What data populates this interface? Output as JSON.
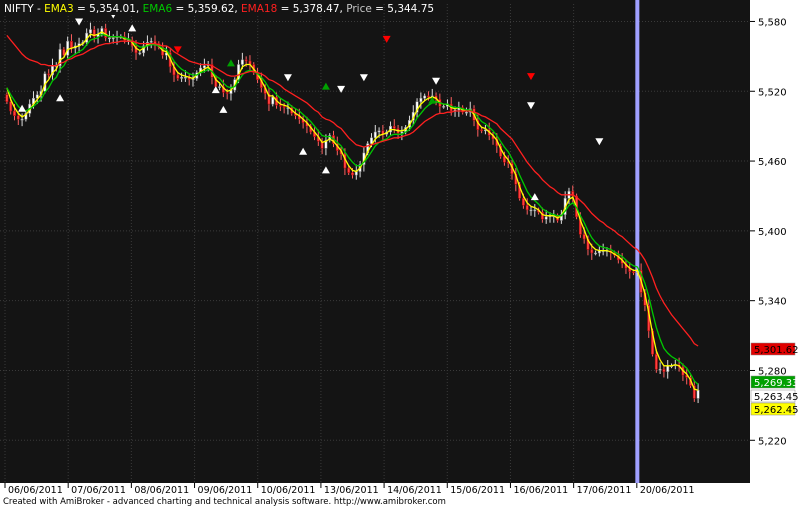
{
  "header": {
    "symbol": "NIFTY",
    "sep": " - ",
    "items": [
      {
        "label": "EMA3",
        "value": " = 5,354.01, ",
        "color": "#ffff00"
      },
      {
        "label": "EMA6",
        "value": " = 5,359.62, ",
        "color": "#00c800"
      },
      {
        "label": "EMA18",
        "value": " = 5,378.47, ",
        "color": "#ff2020"
      },
      {
        "label": "Price",
        "value": " = 5,344.75",
        "color": "#c8c8c8"
      }
    ]
  },
  "footer": {
    "credit": "Created with AmiBroker - advanced charting and technical analysis software. http://www.amibroker.com"
  },
  "chart_data": {
    "type": "candlestick",
    "symbol": "NIFTY",
    "x": [
      "06/06/2011",
      "07/06/2011",
      "08/06/2011",
      "09/06/2011",
      "10/06/2011",
      "13/06/2011",
      "14/06/2011",
      "15/06/2011",
      "16/06/2011",
      "17/06/2011",
      "20/06/2011"
    ],
    "ylim": [
      5185,
      5595
    ],
    "yticks": [
      5220,
      5280,
      5340,
      5400,
      5460,
      5520,
      5580
    ],
    "ytick_labels": [
      "5,220",
      "5,280",
      "5,340",
      "5,400",
      "5,460",
      "5,520",
      "5,580"
    ],
    "series": [
      {
        "name": "Price",
        "style": "candlestick",
        "up_color": "#ffffff",
        "down_color": "#ff4040",
        "close": [
          5511,
          5503,
          5499,
          5496,
          5496,
          5501,
          5509,
          5514,
          5517,
          5520,
          5535,
          5534,
          5542,
          5542,
          5556,
          5551,
          5563,
          5557,
          5559,
          5561,
          5562,
          5570,
          5573,
          5567,
          5569,
          5574,
          5566,
          5566,
          5566,
          5567,
          5567,
          5564,
          5564,
          5559,
          5553,
          5553,
          5559,
          5562,
          5563,
          5561,
          5558,
          5551,
          5553,
          5541,
          5534,
          5531,
          5532,
          5532,
          5530,
          5531,
          5536,
          5540,
          5542,
          5543,
          5532,
          5524,
          5524,
          5519,
          5518,
          5521,
          5530,
          5543,
          5547,
          5546,
          5543,
          5536,
          5530,
          5523,
          5518,
          5509,
          5515,
          5508,
          5507,
          5506,
          5506,
          5501,
          5499,
          5496,
          5493,
          5490,
          5485,
          5481,
          5477,
          5471,
          5478,
          5482,
          5475,
          5469,
          5466,
          5454,
          5450,
          5448,
          5451,
          5457,
          5467,
          5475,
          5480,
          5485,
          5486,
          5483,
          5485,
          5490,
          5488,
          5484,
          5485,
          5489,
          5495,
          5502,
          5511,
          5514,
          5516,
          5515,
          5516,
          5513,
          5507,
          5507,
          5509,
          5503,
          5504,
          5506,
          5502,
          5502,
          5505,
          5495,
          5487,
          5486,
          5487,
          5482,
          5479,
          5473,
          5464,
          5459,
          5458,
          5449,
          5440,
          5428,
          5422,
          5418,
          5418,
          5418,
          5416,
          5410,
          5412,
          5413,
          5413,
          5409,
          5414,
          5428,
          5434,
          5430,
          5412,
          5397,
          5393,
          5384,
          5381,
          5381,
          5383,
          5383,
          5383,
          5381,
          5379,
          5375,
          5372,
          5368,
          5365,
          5364,
          5366,
          5347,
          5336,
          5314,
          5294,
          5281,
          5281,
          5279,
          5284,
          5284,
          5285,
          5283,
          5276,
          5274,
          5267,
          5256,
          5263
        ]
      },
      {
        "name": "EMA3",
        "color": "#ffff00",
        "values": [
          5523,
          5513,
          5506,
          5501,
          5498,
          5500,
          5504,
          5509,
          5513,
          5517,
          5526,
          5530,
          5536,
          5539,
          5547,
          5549,
          5556,
          5557,
          5558,
          5559,
          5561,
          5565,
          5569,
          5568,
          5569,
          5571,
          5569,
          5567,
          5567,
          5567,
          5567,
          5565,
          5565,
          5562,
          5557,
          5555,
          5557,
          5560,
          5561,
          5561,
          5559,
          5555,
          5554,
          5548,
          5541,
          5536,
          5534,
          5533,
          5532,
          5531,
          5534,
          5537,
          5539,
          5541,
          5537,
          5530,
          5527,
          5523,
          5520,
          5521,
          5525,
          5534,
          5541,
          5543,
          5543,
          5539,
          5535,
          5529,
          5523,
          5516,
          5516,
          5512,
          5509,
          5508,
          5507,
          5504,
          5501,
          5499,
          5496,
          5493,
          5489,
          5485,
          5481,
          5476,
          5477,
          5479,
          5477,
          5473,
          5469,
          5462,
          5456,
          5452,
          5451,
          5454,
          5460,
          5468,
          5474,
          5479,
          5482,
          5483,
          5484,
          5487,
          5487,
          5486,
          5486,
          5487,
          5491,
          5497,
          5504,
          5509,
          5512,
          5514,
          5515,
          5514,
          5510,
          5509,
          5509,
          5506,
          5505,
          5506,
          5504,
          5503,
          5504,
          5500,
          5493,
          5489,
          5488,
          5485,
          5482,
          5478,
          5471,
          5465,
          5461,
          5455,
          5448,
          5438,
          5430,
          5424,
          5421,
          5420,
          5418,
          5414,
          5413,
          5413,
          5413,
          5411,
          5413,
          5420,
          5427,
          5429,
          5420,
          5409,
          5401,
          5392,
          5387,
          5384,
          5383,
          5383,
          5383,
          5382,
          5380,
          5378,
          5375,
          5371,
          5368,
          5366,
          5366,
          5357,
          5346,
          5330,
          5312,
          5297,
          5289,
          5284,
          5284,
          5284,
          5285,
          5284,
          5280,
          5277,
          5272,
          5264,
          5263
        ]
      },
      {
        "name": "EMA6",
        "color": "#00c800",
        "values": [
          5523,
          5517,
          5512,
          5507,
          5504,
          5503,
          5505,
          5507,
          5510,
          5513,
          5519,
          5523,
          5529,
          5532,
          5539,
          5542,
          5548,
          5550,
          5552,
          5554,
          5556,
          5560,
          5564,
          5565,
          5566,
          5569,
          5568,
          5567,
          5567,
          5567,
          5567,
          5566,
          5565,
          5563,
          5560,
          5558,
          5558,
          5559,
          5560,
          5560,
          5559,
          5557,
          5556,
          5551,
          5546,
          5542,
          5539,
          5537,
          5535,
          5534,
          5534,
          5536,
          5537,
          5539,
          5537,
          5533,
          5531,
          5527,
          5524,
          5523,
          5524,
          5529,
          5534,
          5537,
          5538,
          5537,
          5535,
          5532,
          5528,
          5523,
          5521,
          5517,
          5514,
          5512,
          5510,
          5507,
          5505,
          5503,
          5500,
          5497,
          5494,
          5490,
          5486,
          5482,
          5481,
          5481,
          5479,
          5476,
          5473,
          5468,
          5463,
          5459,
          5456,
          5456,
          5459,
          5463,
          5468,
          5473,
          5476,
          5478,
          5479,
          5482,
          5483,
          5483,
          5483,
          5485,
          5487,
          5491,
          5497,
          5501,
          5505,
          5508,
          5510,
          5511,
          5510,
          5509,
          5509,
          5507,
          5506,
          5506,
          5505,
          5504,
          5504,
          5502,
          5498,
          5494,
          5492,
          5489,
          5486,
          5482,
          5477,
          5472,
          5468,
          5462,
          5456,
          5448,
          5441,
          5434,
          5429,
          5426,
          5423,
          5419,
          5417,
          5415,
          5414,
          5413,
          5413,
          5417,
          5422,
          5424,
          5420,
          5413,
          5407,
          5400,
          5394,
          5390,
          5387,
          5386,
          5385,
          5384,
          5382,
          5380,
          5378,
          5375,
          5372,
          5370,
          5369,
          5363,
          5355,
          5344,
          5330,
          5317,
          5307,
          5299,
          5295,
          5292,
          5290,
          5288,
          5285,
          5282,
          5277,
          5271,
          5268
        ]
      },
      {
        "name": "EMA18",
        "color": "#ff2020",
        "values": [
          5568,
          5564,
          5560,
          5556,
          5552,
          5549,
          5547,
          5546,
          5545,
          5543,
          5543,
          5542,
          5542,
          5542,
          5544,
          5545,
          5547,
          5548,
          5550,
          5551,
          5552,
          5554,
          5556,
          5557,
          5559,
          5560,
          5561,
          5561,
          5562,
          5562,
          5563,
          5563,
          5563,
          5563,
          5562,
          5561,
          5561,
          5561,
          5561,
          5561,
          5560,
          5559,
          5559,
          5557,
          5554,
          5552,
          5550,
          5548,
          5546,
          5545,
          5544,
          5543,
          5543,
          5543,
          5542,
          5540,
          5538,
          5536,
          5534,
          5533,
          5533,
          5534,
          5535,
          5536,
          5537,
          5537,
          5536,
          5535,
          5533,
          5530,
          5529,
          5527,
          5525,
          5522,
          5520,
          5518,
          5516,
          5514,
          5512,
          5510,
          5507,
          5504,
          5502,
          5498,
          5496,
          5495,
          5493,
          5490,
          5488,
          5484,
          5480,
          5477,
          5474,
          5473,
          5472,
          5473,
          5474,
          5475,
          5476,
          5477,
          5478,
          5479,
          5480,
          5480,
          5481,
          5482,
          5483,
          5485,
          5488,
          5491,
          5494,
          5496,
          5498,
          5500,
          5501,
          5501,
          5502,
          5502,
          5503,
          5503,
          5503,
          5503,
          5503,
          5502,
          5501,
          5499,
          5498,
          5496,
          5494,
          5492,
          5488,
          5485,
          5482,
          5479,
          5474,
          5469,
          5464,
          5459,
          5455,
          5451,
          5448,
          5444,
          5441,
          5438,
          5436,
          5433,
          5431,
          5431,
          5431,
          5431,
          5429,
          5426,
          5423,
          5419,
          5415,
          5412,
          5409,
          5407,
          5404,
          5402,
          5400,
          5397,
          5395,
          5392,
          5389,
          5386,
          5384,
          5380,
          5375,
          5368,
          5360,
          5351,
          5344,
          5338,
          5333,
          5328,
          5324,
          5320,
          5316,
          5312,
          5308,
          5303,
          5301
        ]
      }
    ],
    "signals": {
      "buy": [
        {
          "index": 4,
          "value": 5505
        },
        {
          "index": 14,
          "value": 5514
        },
        {
          "index": 33,
          "value": 5574
        },
        {
          "index": 55,
          "value": 5521
        },
        {
          "index": 57,
          "value": 5504
        },
        {
          "index": 78,
          "value": 5468
        },
        {
          "index": 84,
          "value": 5452
        },
        {
          "index": 139,
          "value": 5429
        }
      ],
      "sell": [
        {
          "index": 19,
          "value": 5580
        },
        {
          "index": 28,
          "value": 5586
        },
        {
          "index": 74,
          "value": 5532
        },
        {
          "index": 88,
          "value": 5522
        },
        {
          "index": 94,
          "value": 5532
        },
        {
          "index": 113,
          "value": 5529
        },
        {
          "index": 138,
          "value": 5508
        },
        {
          "index": 156,
          "value": 5477
        }
      ],
      "buy_strong": [
        {
          "index": 59,
          "value": 5544
        },
        {
          "index": 84,
          "value": 5524
        },
        {
          "index": 112,
          "value": 5512
        }
      ],
      "sell_strong": [
        {
          "index": 45,
          "value": 5556
        },
        {
          "index": 100,
          "value": 5565
        },
        {
          "index": 138,
          "value": 5533
        }
      ]
    },
    "last_values": [
      {
        "label": "5,301.62",
        "value": 5301.62,
        "bg": "#e00000",
        "fg": "#000000"
      },
      {
        "label": "5,269.33",
        "value": 5269.33,
        "bg": "#00a000",
        "fg": "#ffffff"
      },
      {
        "label": "5,263.45",
        "value": 5263.45,
        "bg": "#ffffff",
        "fg": "#000000"
      },
      {
        "label": "5,262.45",
        "value": 5262.45,
        "bg": "#ffff00",
        "fg": "#000000"
      }
    ],
    "cursor_index": 166,
    "grid": true,
    "legend": "top-left"
  },
  "colors": {
    "plot_bg": "#141414",
    "axis_bg": "#ffffff",
    "grid": "#3a3a3a",
    "cursor": "#a0a0ff",
    "buy_marker": "#ffffff",
    "sell_marker": "#ffffff",
    "buy_strong_marker": "#00a000",
    "sell_strong_marker": "#ff0000"
  }
}
